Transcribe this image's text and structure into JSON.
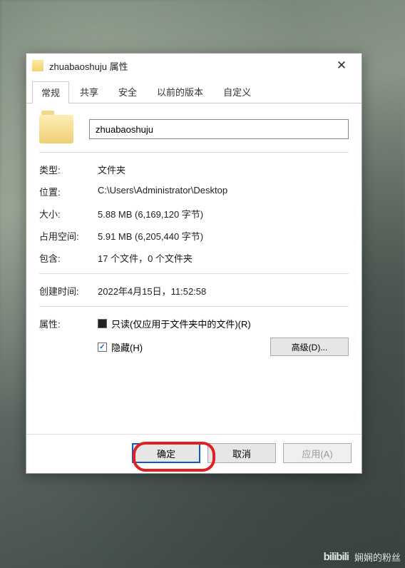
{
  "titlebar": {
    "title": "zhuabaoshuju 属性"
  },
  "tabs": [
    {
      "label": "常规",
      "active": true
    },
    {
      "label": "共享"
    },
    {
      "label": "安全"
    },
    {
      "label": "以前的版本"
    },
    {
      "label": "自定义"
    }
  ],
  "name_value": "zhuabaoshuju",
  "props": {
    "type_label": "类型:",
    "type_value": "文件夹",
    "location_label": "位置:",
    "location_value": "C:\\Users\\Administrator\\Desktop",
    "size_label": "大小:",
    "size_value": "5.88 MB (6,169,120 字节)",
    "sizeondisk_label": "占用空间:",
    "sizeondisk_value": "5.91 MB (6,205,440 字节)",
    "contains_label": "包含:",
    "contains_value": "17 个文件，0 个文件夹",
    "created_label": "创建时间:",
    "created_value": "2022年4月15日，11:52:58",
    "attr_label": "属性:",
    "readonly_label": "只读(仅应用于文件夹中的文件)(R)",
    "hidden_label": "隐藏(H)",
    "advanced_label": "高级(D)..."
  },
  "buttons": {
    "ok": "确定",
    "cancel": "取消",
    "apply": "应用(A)"
  },
  "watermark": {
    "logo": "bilibili",
    "text": "娴娴的粉丝"
  }
}
